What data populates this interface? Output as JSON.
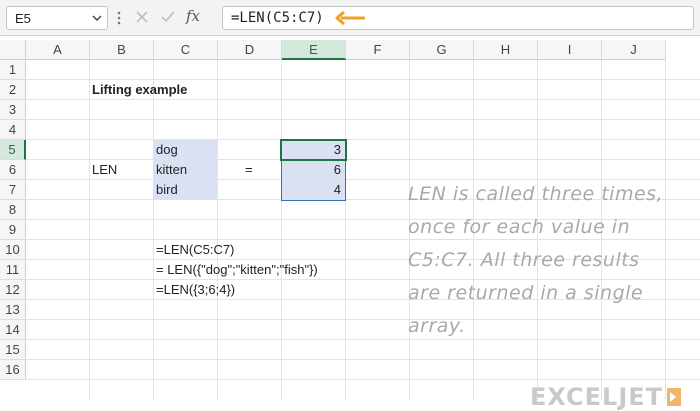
{
  "formula_bar": {
    "name_box": "E5",
    "formula": "=LEN(C5:C7)",
    "fx_label": "fx"
  },
  "columns": [
    "A",
    "B",
    "C",
    "D",
    "E",
    "F",
    "G",
    "H",
    "I",
    "J"
  ],
  "rows": [
    "1",
    "2",
    "3",
    "4",
    "5",
    "6",
    "7",
    "8",
    "9",
    "10",
    "11",
    "12",
    "13",
    "14",
    "15",
    "16"
  ],
  "active": {
    "column": "E",
    "row": "5"
  },
  "cells": {
    "B2": "Lifting example",
    "B6": "LEN",
    "C5": "dog",
    "C6": "kitten",
    "C7": "bird",
    "D6": "=",
    "E5": "3",
    "E6": "6",
    "E7": "4",
    "C10": "=LEN(C5:C7)",
    "C11": "= LEN({\"dog\";\"kitten\";\"fish\"})",
    "C12": "=LEN({3;6;4})"
  },
  "note": "LEN is called three times, once for each value in C5:C7. All three results are returned in a single array.",
  "logo": "EXCELJET",
  "colors": {
    "accent_arrow": "#f0a020",
    "active_green": "#217346",
    "fill_blue": "#d9e1f2",
    "selection_border": "#3a6fb5"
  }
}
